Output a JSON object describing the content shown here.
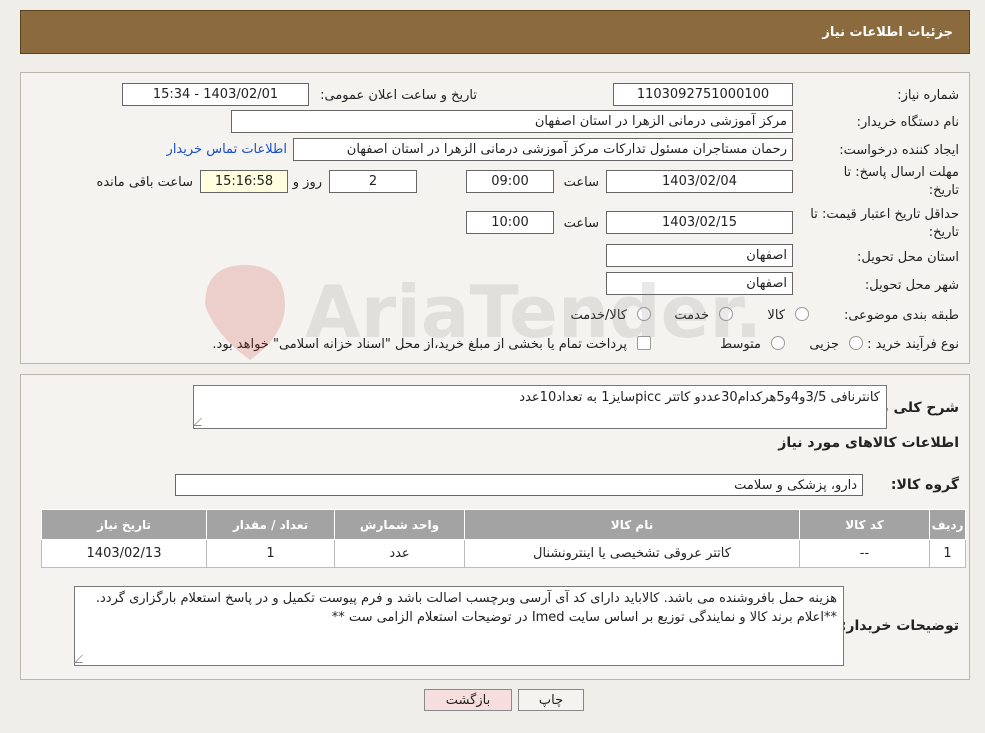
{
  "header": {
    "title": "جزئیات اطلاعات نیاز"
  },
  "form": {
    "need_number_label": "شماره نیاز:",
    "need_number": "1103092751000100",
    "announce_label": "تاریخ و ساعت اعلان عمومی:",
    "announce_value": "1403/02/01 - 15:34",
    "buyer_label": "نام دستگاه خریدار:",
    "buyer_value": "مرکز آموزشی درمانی الزهرا در استان اصفهان",
    "creator_label": "ایجاد کننده درخواست:",
    "creator_value": "رحمان مستاجران مسئول تدارکات مرکز آموزشی درمانی الزهرا در استان اصفهان",
    "contact_link": "اطلاعات تماس خریدار",
    "deadline_label_1": "مهلت ارسال پاسخ: تا",
    "deadline_label_2": "تاریخ:",
    "deadline_date": "1403/02/04",
    "time_label": "ساعت",
    "deadline_time": "09:00",
    "days_value": "2",
    "days_label": "روز و",
    "remaining_time": "15:16:58",
    "remaining_label": "ساعت باقی مانده",
    "validity_label_1": "حداقل تاریخ اعتبار قیمت: تا",
    "validity_label_2": "تاریخ:",
    "validity_date": "1403/02/15",
    "validity_time": "10:00",
    "province_label": "استان محل تحویل:",
    "province_value": "اصفهان",
    "city_label": "شهر محل تحویل:",
    "city_value": "اصفهان",
    "category_label": "طبقه بندی موضوعی:",
    "category_options": [
      "کالا",
      "خدمت",
      "کالا/خدمت"
    ],
    "process_label": "نوع فرآیند خرید :",
    "process_options": [
      "جزیی",
      "متوسط"
    ],
    "process_note": "پرداخت تمام یا بخشی از مبلغ خرید،از محل \"اسناد خزانه اسلامی\" خواهد بود."
  },
  "details": {
    "desc_label": "شرح کلی نیاز:",
    "desc_value": "کانترنافی 3/5و4و5هرکدام30عددو کاتتر piccسایز1 به تعداد10عدد",
    "goods_heading": "اطلاعات کالاهای مورد نیاز",
    "group_label": "گروه کالا:",
    "group_value": "دارو، پزشکی و سلامت",
    "table_headers": [
      "ردیف",
      "کد کالا",
      "نام کالا",
      "واحد شمارش",
      "تعداد / مقدار",
      "تاریخ نیاز"
    ],
    "table_rows": [
      [
        "1",
        "--",
        "کاتتر عروقی تشخیصی یا اینترونشنال",
        "عدد",
        "1",
        "1403/02/13"
      ]
    ],
    "buyer_notes_label": "توضیحات خریدار:",
    "buyer_notes_value": "هزینه حمل بافروشنده می باشد. کالاباید دارای کد آی آرسی وبرچسب اصالت باشد و فرم پیوست تکمیل و در پاسخ استعلام بارگزاری گردد. **اعلام برند کالا و نمایندگی توزیع بر اساس سایت Imed در توضیحات استعلام الزامی ست **"
  },
  "buttons": {
    "print": "چاپ",
    "back": "بازگشت"
  },
  "watermark": {
    "text": "AriaTender.neT"
  },
  "colors": {
    "header_bg": "#8b6a3e",
    "link": "#1a4fc4",
    "table_header": "#a3a3a3",
    "back_button": "#f7dede"
  }
}
